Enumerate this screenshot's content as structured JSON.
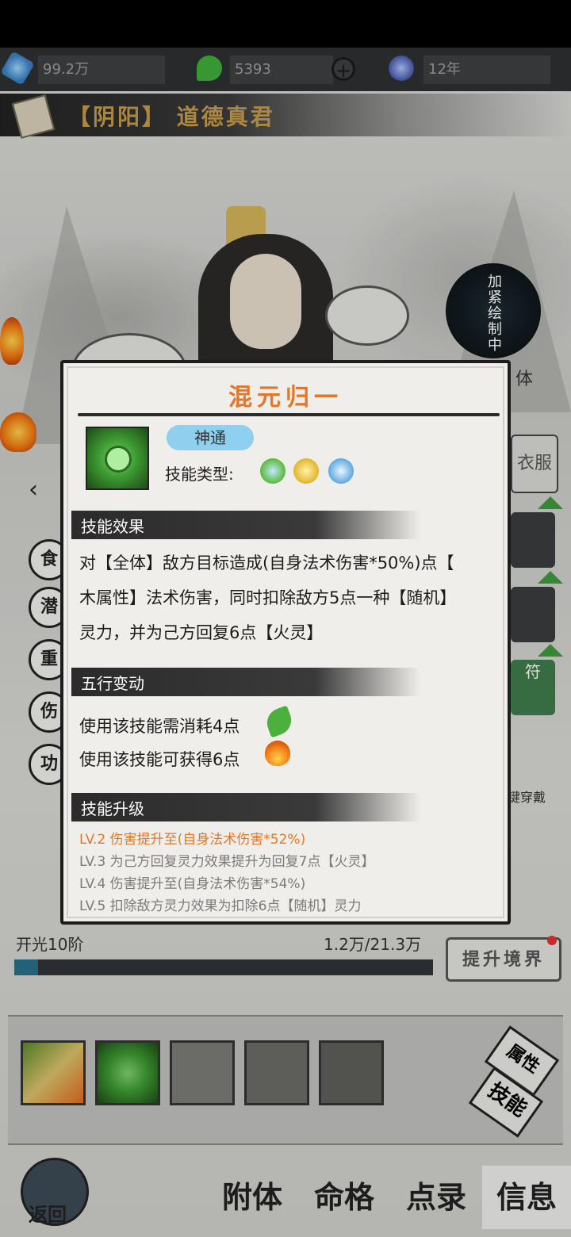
{
  "resources": {
    "spirit_stones": "99.2万",
    "jade": "5393",
    "time": "12年"
  },
  "character": {
    "title": "【阴阳】 道德真君"
  },
  "seal": {
    "text": "加紧绘制中"
  },
  "side_labels": {
    "attach": "体",
    "clothing": "衣服",
    "talisman": "符",
    "one_click_equip": "键穿戴"
  },
  "left_menu": [
    "食",
    "潜",
    "重",
    "伤",
    "功"
  ],
  "progress": {
    "realm": "开光10阶",
    "exp": "1.2万/21.3万",
    "fill_fraction": 0.057,
    "upgrade_label": "提升境界"
  },
  "switch": {
    "top": "属性",
    "bottom": "技能"
  },
  "bottom_nav": {
    "back": "返回",
    "items": [
      "附体",
      "命格",
      "点录",
      "信息"
    ],
    "active_index": 3
  },
  "dialog": {
    "title": "混元归一",
    "type_tag": "神通",
    "type_label": "技能类型:",
    "type_icons": [
      "support-icon",
      "wing-icon",
      "assist-icon"
    ],
    "sections": {
      "effect": "技能效果",
      "wuxing": "五行变动",
      "upgrade": "技能升级"
    },
    "effect_lines": [
      "对【全体】敌方目标造成(自身法术伤害*50%)点【",
      "木属性】法术伤害，同时扣除敌方5点一种【随机】",
      "灵力，并为己方回复6点【火灵】"
    ],
    "wuxing_lines": [
      "使用该技能需消耗4点",
      "使用该技能可获得6点"
    ],
    "upgrades": [
      "LV.2 伤害提升至(自身法术伤害*52%)",
      "LV.3 为己方回复灵力效果提升为回复7点【火灵】",
      "LV.4 伤害提升至(自身法术伤害*54%)",
      "LV.5 扣除敌方灵力效果为扣除6点【随机】灵力"
    ]
  },
  "colors": {
    "accent_orange": "#e2762a",
    "tag_blue": "#8fd0ee",
    "wood_green": "#3d9a32",
    "fire_red": "#e24a18"
  }
}
